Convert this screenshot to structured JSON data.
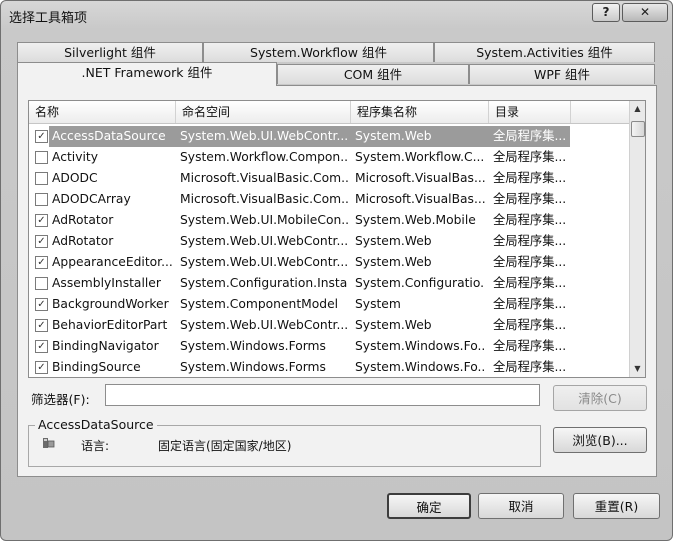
{
  "window": {
    "title": "选择工具箱项",
    "help_label": "?",
    "close_label": "✕"
  },
  "tabs_row1": [
    "Silverlight 组件",
    "System.Workflow 组件",
    "System.Activities 组件"
  ],
  "tabs_row2": [
    ".NET Framework 组件",
    "COM 组件",
    "WPF 组件"
  ],
  "active_tab": ".NET Framework 组件",
  "columns": [
    "名称",
    "命名空间",
    "程序集名称",
    "目录"
  ],
  "rows": [
    {
      "checked": true,
      "name": "AccessDataSource",
      "namespace": "System.Web.UI.WebContr...",
      "assembly": "System.Web",
      "directory": "全局程序集...",
      "selected": true
    },
    {
      "checked": false,
      "name": "Activity",
      "namespace": "System.Workflow.Compon...",
      "assembly": "System.Workflow.C...",
      "directory": "全局程序集..."
    },
    {
      "checked": false,
      "name": "ADODC",
      "namespace": "Microsoft.VisualBasic.Com...",
      "assembly": "Microsoft.VisualBas...",
      "directory": "全局程序集..."
    },
    {
      "checked": false,
      "name": "ADODCArray",
      "namespace": "Microsoft.VisualBasic.Com...",
      "assembly": "Microsoft.VisualBas...",
      "directory": "全局程序集..."
    },
    {
      "checked": true,
      "name": "AdRotator",
      "namespace": "System.Web.UI.MobileCon...",
      "assembly": "System.Web.Mobile",
      "directory": "全局程序集..."
    },
    {
      "checked": true,
      "name": "AdRotator",
      "namespace": "System.Web.UI.WebContr...",
      "assembly": "System.Web",
      "directory": "全局程序集..."
    },
    {
      "checked": true,
      "name": "AppearanceEditor...",
      "namespace": "System.Web.UI.WebContr...",
      "assembly": "System.Web",
      "directory": "全局程序集..."
    },
    {
      "checked": false,
      "name": "AssemblyInstaller",
      "namespace": "System.Configuration.Install",
      "assembly": "System.Configuratio...",
      "directory": "全局程序集..."
    },
    {
      "checked": true,
      "name": "BackgroundWorker",
      "namespace": "System.ComponentModel",
      "assembly": "System",
      "directory": "全局程序集..."
    },
    {
      "checked": true,
      "name": "BehaviorEditorPart",
      "namespace": "System.Web.UI.WebContr...",
      "assembly": "System.Web",
      "directory": "全局程序集..."
    },
    {
      "checked": true,
      "name": "BindingNavigator",
      "namespace": "System.Windows.Forms",
      "assembly": "System.Windows.Fo...",
      "directory": "全局程序集..."
    },
    {
      "checked": true,
      "name": "BindingSource",
      "namespace": "System.Windows.Forms",
      "assembly": "System.Windows.Fo...",
      "directory": "全局程序集..."
    }
  ],
  "filter": {
    "label": "筛选器(F):",
    "value": "",
    "clear_label": "清除(C)"
  },
  "info": {
    "title": "AccessDataSource",
    "lang_label": "语言:",
    "lang_value": "固定语言(固定国家/地区)",
    "browse_label": "浏览(B)..."
  },
  "buttons": {
    "ok": "确定",
    "cancel": "取消",
    "reset": "重置(R)"
  },
  "icons": {
    "check": "check-icon",
    "scroll_up": "scroll-up-icon",
    "scroll_down": "scroll-down-icon",
    "assembly": "assembly-icon"
  }
}
